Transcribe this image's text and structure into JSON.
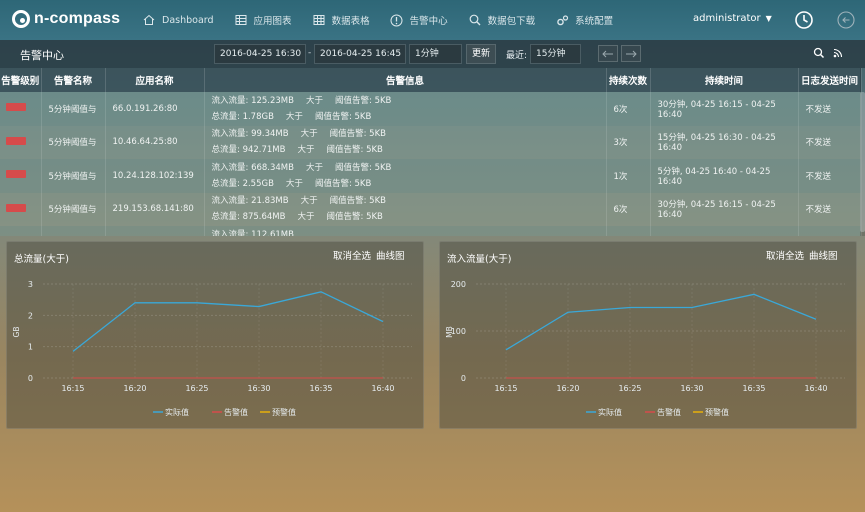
{
  "app": {
    "logo": "n-compass"
  },
  "nav": [
    {
      "label": "Dashboard",
      "icon": "home-icon"
    },
    {
      "label": "应用图表",
      "icon": "chart-table-icon"
    },
    {
      "label": "数据表格",
      "icon": "grid-icon"
    },
    {
      "label": "告警中心",
      "icon": "alert-icon"
    },
    {
      "label": "数据包下载",
      "icon": "search-icon"
    },
    {
      "label": "系统配置",
      "icon": "gear-icon"
    }
  ],
  "user": {
    "name": "administrator"
  },
  "toolbar": {
    "title": "告警中心",
    "start_time": "2016-04-25 16:30",
    "separator": "-",
    "end_time": "2016-04-25 16:45",
    "interval": "1分钟",
    "refresh_label": "更新",
    "recent_label": "最近:",
    "recent_value": "15分钟"
  },
  "table": {
    "headers": [
      "告警级别",
      "告警名称",
      "应用名称",
      "告警信息",
      "持续次数",
      "持续时间",
      "日志发送时间"
    ],
    "rows": [
      {
        "name": "5分钟阈值与",
        "app": "66.0.191.26:80",
        "line1": [
          "流入流量: 125.23MB",
          "大于",
          "阈值告警: 5KB"
        ],
        "line2": [
          "总流量: 1.78GB",
          "大于",
          "阈值告警: 5KB"
        ],
        "count": "6次",
        "duration": "30分钟, 04-25 16:15 - 04-25 16:40",
        "log": "不发送"
      },
      {
        "name": "5分钟阈值与",
        "app": "10.46.64.25:80",
        "line1": [
          "流入流量: 99.34MB",
          "大于",
          "阈值告警: 5KB"
        ],
        "line2": [
          "总流量: 942.71MB",
          "大于",
          "阈值告警: 5KB"
        ],
        "count": "3次",
        "duration": "15分钟, 04-25 16:30 - 04-25 16:40",
        "log": "不发送"
      },
      {
        "name": "5分钟阈值与",
        "app": "10.24.128.102:139",
        "line1": [
          "流入流量: 668.34MB",
          "大于",
          "阈值告警: 5KB"
        ],
        "line2": [
          "总流量: 2.55GB",
          "大于",
          "阈值告警: 5KB"
        ],
        "count": "1次",
        "duration": "5分钟, 04-25 16:40 - 04-25 16:40",
        "log": "不发送"
      },
      {
        "name": "5分钟阈值与",
        "app": "219.153.68.141:80",
        "line1": [
          "流入流量: 21.83MB",
          "大于",
          "阈值告警: 5KB"
        ],
        "line2": [
          "总流量: 875.64MB",
          "大于",
          "阈值告警: 5KB"
        ],
        "count": "6次",
        "duration": "30分钟, 04-25 16:15 - 04-25 16:40",
        "log": "不发送"
      },
      {
        "name": "",
        "app": "",
        "line1": [
          "流入流量: 112.61MB",
          "",
          ""
        ],
        "line2": [
          "",
          "",
          ""
        ],
        "count": "",
        "duration": "",
        "log": ""
      }
    ]
  },
  "panels": [
    {
      "title": "总流量(大于)",
      "deselect_label": "取消全选",
      "curve_label": "曲线图"
    },
    {
      "title": "流入流量(大于)",
      "deselect_label": "取消全选",
      "curve_label": "曲线图"
    }
  ],
  "chart_data": [
    {
      "type": "line",
      "title": "总流量(大于)",
      "ylabel": "GB",
      "x": [
        "16:15",
        "16:20",
        "16:25",
        "16:30",
        "16:35",
        "16:40"
      ],
      "ylim": [
        0,
        3
      ],
      "yticks": [
        0,
        1,
        2,
        3
      ],
      "series": [
        {
          "name": "实际值",
          "color": "#3aa8d8",
          "values": [
            0.85,
            2.4,
            2.4,
            2.28,
            2.75,
            1.8
          ]
        },
        {
          "name": "告警值",
          "color": "#d64b4b",
          "values": [
            0,
            0,
            0,
            0,
            0,
            0
          ]
        },
        {
          "name": "预警值",
          "color": "#e8b00a",
          "values": [
            0,
            0,
            0,
            0,
            0,
            0
          ]
        }
      ]
    },
    {
      "type": "line",
      "title": "流入流量(大于)",
      "ylabel": "MB",
      "x": [
        "16:15",
        "16:20",
        "16:25",
        "16:30",
        "16:35",
        "16:40"
      ],
      "ylim": [
        0,
        200
      ],
      "yticks": [
        0,
        100,
        200
      ],
      "series": [
        {
          "name": "实际值",
          "color": "#3aa8d8",
          "values": [
            60,
            140,
            150,
            150,
            178,
            125
          ]
        },
        {
          "name": "告警值",
          "color": "#d64b4b",
          "values": [
            0,
            0,
            0,
            0,
            0,
            0
          ]
        },
        {
          "name": "预警值",
          "color": "#e8b00a",
          "values": [
            0,
            0,
            0,
            0,
            0,
            0
          ]
        }
      ]
    }
  ]
}
